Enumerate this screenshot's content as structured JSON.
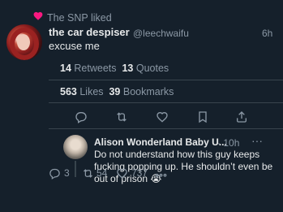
{
  "liked_banner": {
    "text": "The SNP liked"
  },
  "tweet": {
    "display_name": "the car despiser",
    "handle": "@leechwaifu",
    "time": "6h",
    "body": "excuse me",
    "retweets": "14",
    "retweets_label": "Retweets",
    "quotes": "13",
    "quotes_label": "Quotes",
    "likes": "563",
    "likes_label": "Likes",
    "bookmarks": "39",
    "bookmarks_label": "Bookmarks"
  },
  "reply": {
    "display_name": "Alison Wonderland Baby U...",
    "separator": "·",
    "time": "10h",
    "more": "···",
    "body": "Do not understand how this guy keeps fucking popping up. He shouldn’t even be out of prison 😭",
    "replies": "3",
    "retweets": "54",
    "likes": "737"
  },
  "colors": {
    "background": "#15202b",
    "text": "#e7e9ea",
    "muted": "#8b98a5",
    "heart": "#f91880",
    "divider": "#38444d"
  },
  "icons": [
    "heart-icon",
    "reply-icon",
    "retweet-icon",
    "like-icon",
    "bookmark-icon",
    "share-icon",
    "more-icon",
    "views-icon"
  ]
}
